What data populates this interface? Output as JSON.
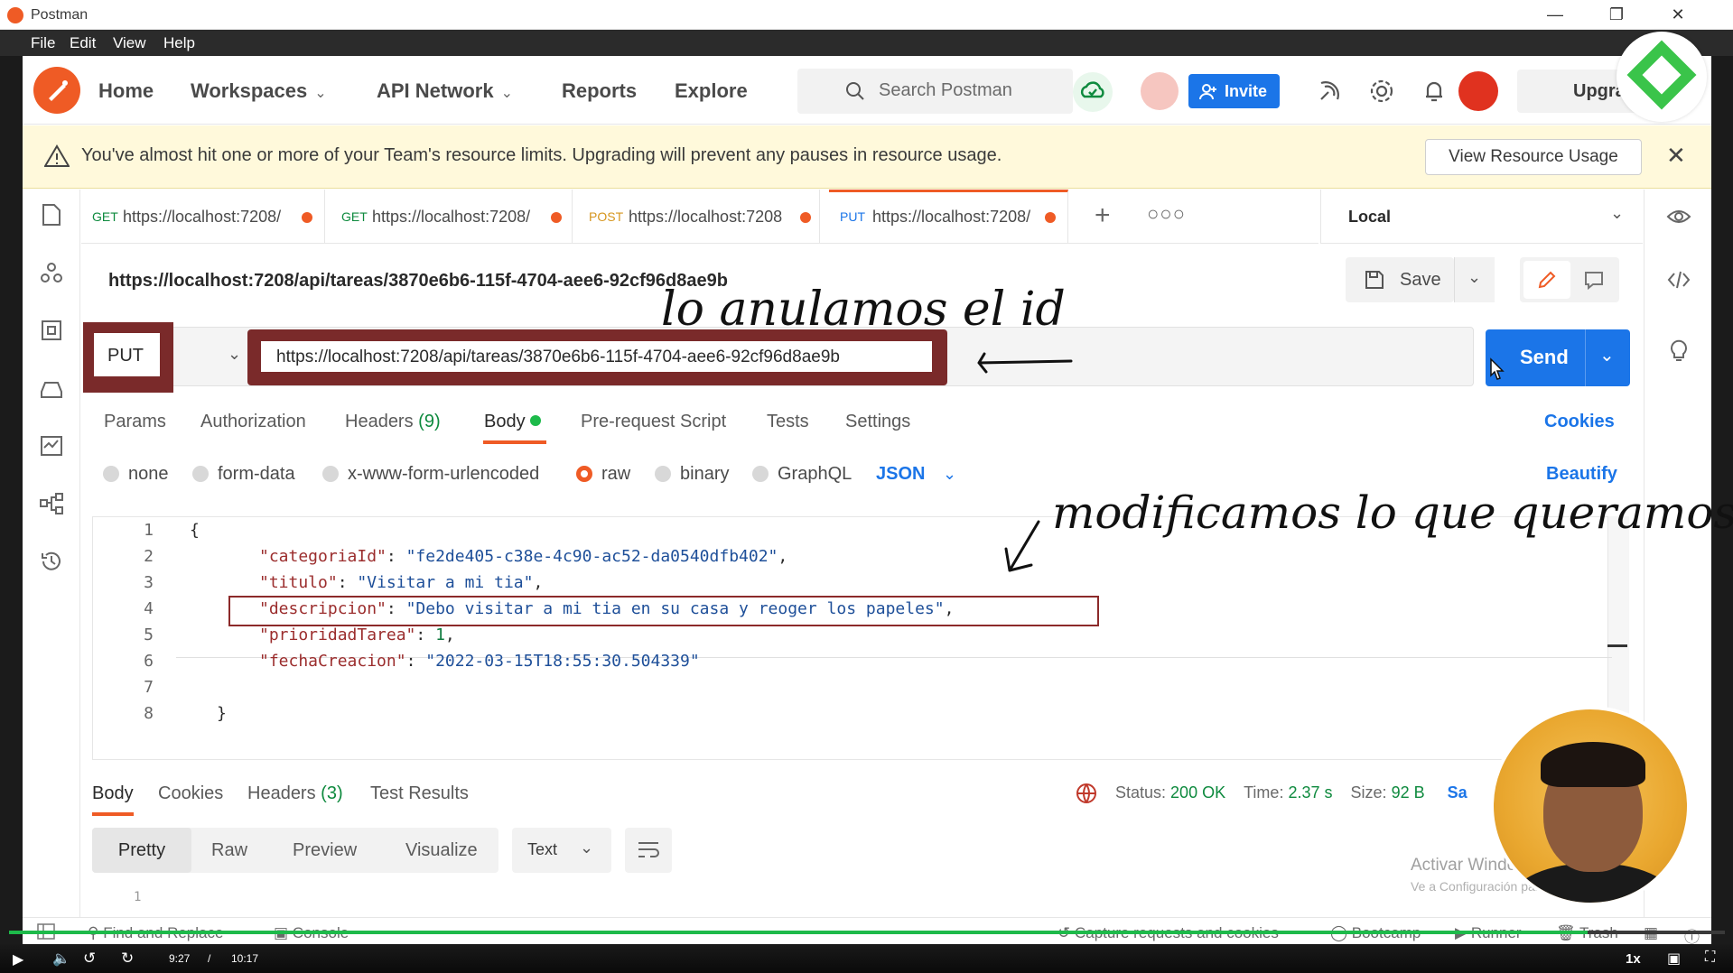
{
  "window": {
    "title": "Postman"
  },
  "menu": [
    "File",
    "Edit",
    "View",
    "Help"
  ],
  "header": {
    "nav": [
      {
        "label": "Home"
      },
      {
        "label": "Workspaces"
      },
      {
        "label": "API Network"
      },
      {
        "label": "Reports"
      },
      {
        "label": "Explore"
      }
    ],
    "search_placeholder": "Search Postman",
    "invite_label": "Invite",
    "upgrade_label": "Upgrade"
  },
  "banner": {
    "message": "You've almost hit one or more of your Team's resource limits. Upgrading will prevent any pauses in resource usage.",
    "button": "View Resource Usage"
  },
  "tabs": [
    {
      "method": "GET",
      "url": "https://localhost:7208/",
      "method_color": "#0e8a3e"
    },
    {
      "method": "GET",
      "url": "https://localhost:7208/",
      "method_color": "#0e8a3e"
    },
    {
      "method": "POST",
      "url": "https://localhost:7208",
      "method_color": "#d6961e"
    },
    {
      "method": "PUT",
      "url": "https://localhost:7208/",
      "method_color": "#1b75e8"
    }
  ],
  "environment": "Local",
  "request": {
    "name": "https://localhost:7208/api/tareas/3870e6b6-115f-4704-aee6-92cf96d8ae9b",
    "method": "PUT",
    "url": "https://localhost:7208/api/tareas/3870e6b6-115f-4704-aee6-92cf96d8ae9b",
    "save_label": "Save",
    "send_label": "Send",
    "subtabs": [
      "Params",
      "Authorization",
      "Headers",
      "Body",
      "Pre-request Script",
      "Tests",
      "Settings"
    ],
    "headers_count": "(9)",
    "cookies_label": "Cookies",
    "body_types": [
      "none",
      "form-data",
      "x-www-form-urlencoded",
      "raw",
      "binary",
      "GraphQL"
    ],
    "selected_body_type": "raw",
    "format": "JSON",
    "beautify_label": "Beautify"
  },
  "code": {
    "line_numbers": [
      "1",
      "2",
      "3",
      "4",
      "5",
      "6",
      "7",
      "8"
    ],
    "open_brace": "{",
    "close_brace": "}",
    "lines": [
      {
        "key": "\"categoriaId\"",
        "value": "\"fe2de405-c38e-4c90-ac52-da0540dfb402\"",
        "trail": ","
      },
      {
        "key": "\"titulo\"",
        "value": "\"Visitar a mi tia\"",
        "trail": ","
      },
      {
        "key": "\"descripcion\"",
        "value": "\"Debo visitar a mi tia en su casa y reoger los papeles\"",
        "trail": ","
      },
      {
        "key": "\"prioridadTarea\"",
        "value": "1",
        "trail": ","
      },
      {
        "key": "\"fechaCreacion\"",
        "value": "\"2022-03-15T18:55:30.504339\"",
        "trail": ""
      }
    ]
  },
  "response": {
    "tabs": [
      "Body",
      "Cookies",
      "Headers",
      "Test Results"
    ],
    "headers_count": "(3)",
    "status_label": "Status:",
    "status_value": "200 OK",
    "time_label": "Time:",
    "time_value": "2.37 s",
    "size_label": "Size:",
    "size_value": "92 B",
    "save_trunc": "Sa",
    "views": [
      "Pretty",
      "Raw",
      "Preview",
      "Visualize"
    ],
    "text_format": "Text",
    "first_line": "1"
  },
  "footer": {
    "find_replace": "Find and Replace",
    "console": "Console",
    "capture": "Capture requests and cookies",
    "bootcamp": "Bootcamp",
    "runner": "Runner",
    "trash": "Trash"
  },
  "watermark": {
    "line1": "Activar Windows",
    "line2": "Ve a Configuración para activar Windows."
  },
  "player": {
    "current_time": "9:27",
    "separator": "/",
    "duration": "10:17",
    "speed": "1x",
    "progress": 0.92
  },
  "annotations": {
    "note1": "lo anulamos el id",
    "note2": "modificamos lo que queramos"
  },
  "colors": {
    "accent": "#ef5b25",
    "primary": "#1b75e8",
    "success": "#0e8a3e",
    "highlight": "#7a2a2a"
  }
}
